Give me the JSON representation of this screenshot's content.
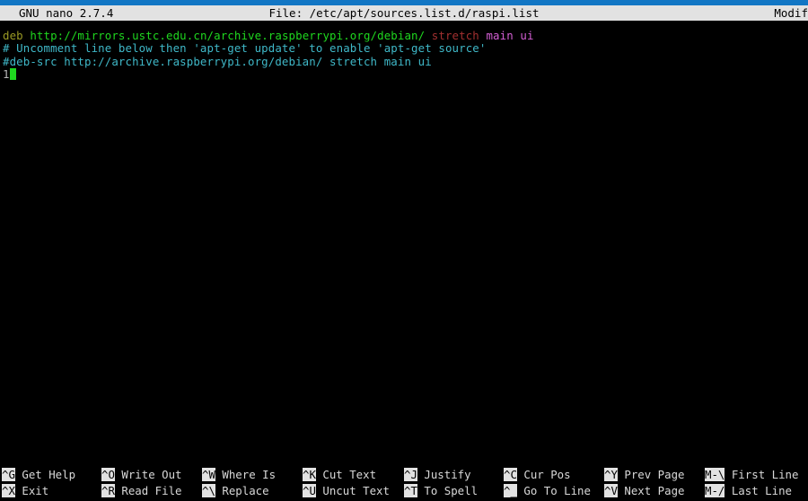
{
  "window": {
    "accent_color": "#1276c4"
  },
  "titlebar": {
    "app": "GNU nano 2.7.4",
    "file": "File: /etc/apt/sources.list.d/raspi.list",
    "modified": "Modif"
  },
  "editor": {
    "lines": [
      {
        "segments": [
          {
            "text": "deb ",
            "class": "c-deb"
          },
          {
            "text": "http://mirrors.ustc.edu.cn/archive.raspberrypi.org/debian/ ",
            "class": "c-url"
          },
          {
            "text": "stretch ",
            "class": "c-suite"
          },
          {
            "text": "main ui",
            "class": "c-comp"
          }
        ]
      },
      {
        "segments": [
          {
            "text": "# Uncomment line below then 'apt-get update' to enable 'apt-get source'",
            "class": "c-comment"
          }
        ]
      },
      {
        "segments": [
          {
            "text": "#deb-src http://archive.raspberrypi.org/debian/ stretch main ui",
            "class": "c-comment"
          }
        ]
      },
      {
        "segments": [
          {
            "text": "1",
            "class": "c-plain"
          }
        ],
        "cursor": true
      }
    ],
    "line1_deb": "deb ",
    "line1_url": "http://mirrors.ustc.edu.cn/archive.raspberrypi.org/debian/ ",
    "line1_suite": "stretch ",
    "line1_components": "main ui",
    "line2": "# Uncomment line below then 'apt-get update' to enable 'apt-get source'",
    "line3": "#deb-src http://archive.raspberrypi.org/debian/ stretch main ui",
    "line4": "1",
    "colors": {
      "deb": "#9a9a24",
      "url": "#1fd81f",
      "suite": "#a33030",
      "components": "#d45fd4",
      "comment": "#3fb8c8",
      "plain": "#b8b8b8",
      "cursor": "#1fd81f"
    }
  },
  "helpbar": {
    "shortcuts": [
      {
        "key": "^G",
        "label": "Get Help",
        "col": 0,
        "row": 0
      },
      {
        "key": "^X",
        "label": "Exit",
        "col": 0,
        "row": 1
      },
      {
        "key": "^O",
        "label": "Write Out",
        "col": 1,
        "row": 0
      },
      {
        "key": "^R",
        "label": "Read File",
        "col": 1,
        "row": 1
      },
      {
        "key": "^W",
        "label": "Where Is",
        "col": 2,
        "row": 0
      },
      {
        "key": "^\\",
        "label": "Replace",
        "col": 2,
        "row": 1
      },
      {
        "key": "^K",
        "label": "Cut Text",
        "col": 3,
        "row": 0
      },
      {
        "key": "^U",
        "label": "Uncut Text",
        "col": 3,
        "row": 1
      },
      {
        "key": "^J",
        "label": "Justify",
        "col": 4,
        "row": 0
      },
      {
        "key": "^T",
        "label": "To Spell",
        "col": 4,
        "row": 1
      },
      {
        "key": "^C",
        "label": "Cur Pos",
        "col": 5,
        "row": 0
      },
      {
        "key": "^_",
        "label": "Go To Line",
        "col": 5,
        "row": 1
      },
      {
        "key": "^Y",
        "label": "Prev Page",
        "col": 6,
        "row": 0
      },
      {
        "key": "^V",
        "label": "Next Page",
        "col": 6,
        "row": 1
      },
      {
        "key": "M-\\",
        "label": "First Line",
        "col": 7,
        "row": 0
      },
      {
        "key": "M-/",
        "label": "Last Line",
        "col": 7,
        "row": 1
      }
    ]
  }
}
